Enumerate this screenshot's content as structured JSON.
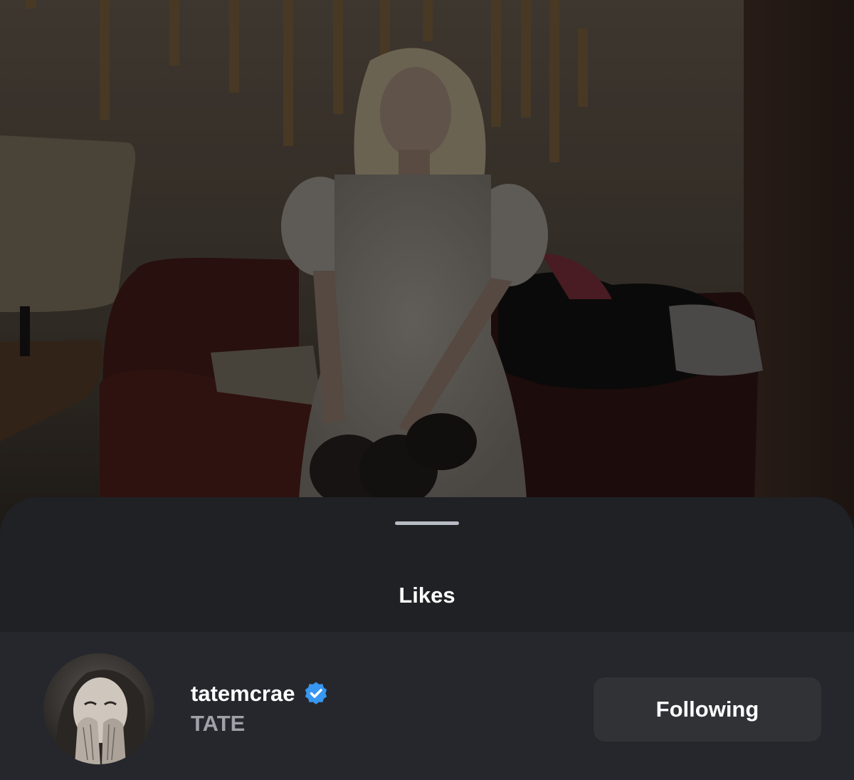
{
  "sheet": {
    "title": "Likes"
  },
  "likes": [
    {
      "username": "tatemcrae",
      "verified": true,
      "full_name": "TATE",
      "follow_button_label": "Following"
    }
  ],
  "colors": {
    "sheet_background": "#1f2125",
    "row_background": "#25272c",
    "button_background": "#303236",
    "verified_badge": "#3897f0",
    "secondary_text": "#9ea1a8"
  },
  "icons": {
    "verified": "verified-badge-icon",
    "handle": "drag-handle"
  }
}
